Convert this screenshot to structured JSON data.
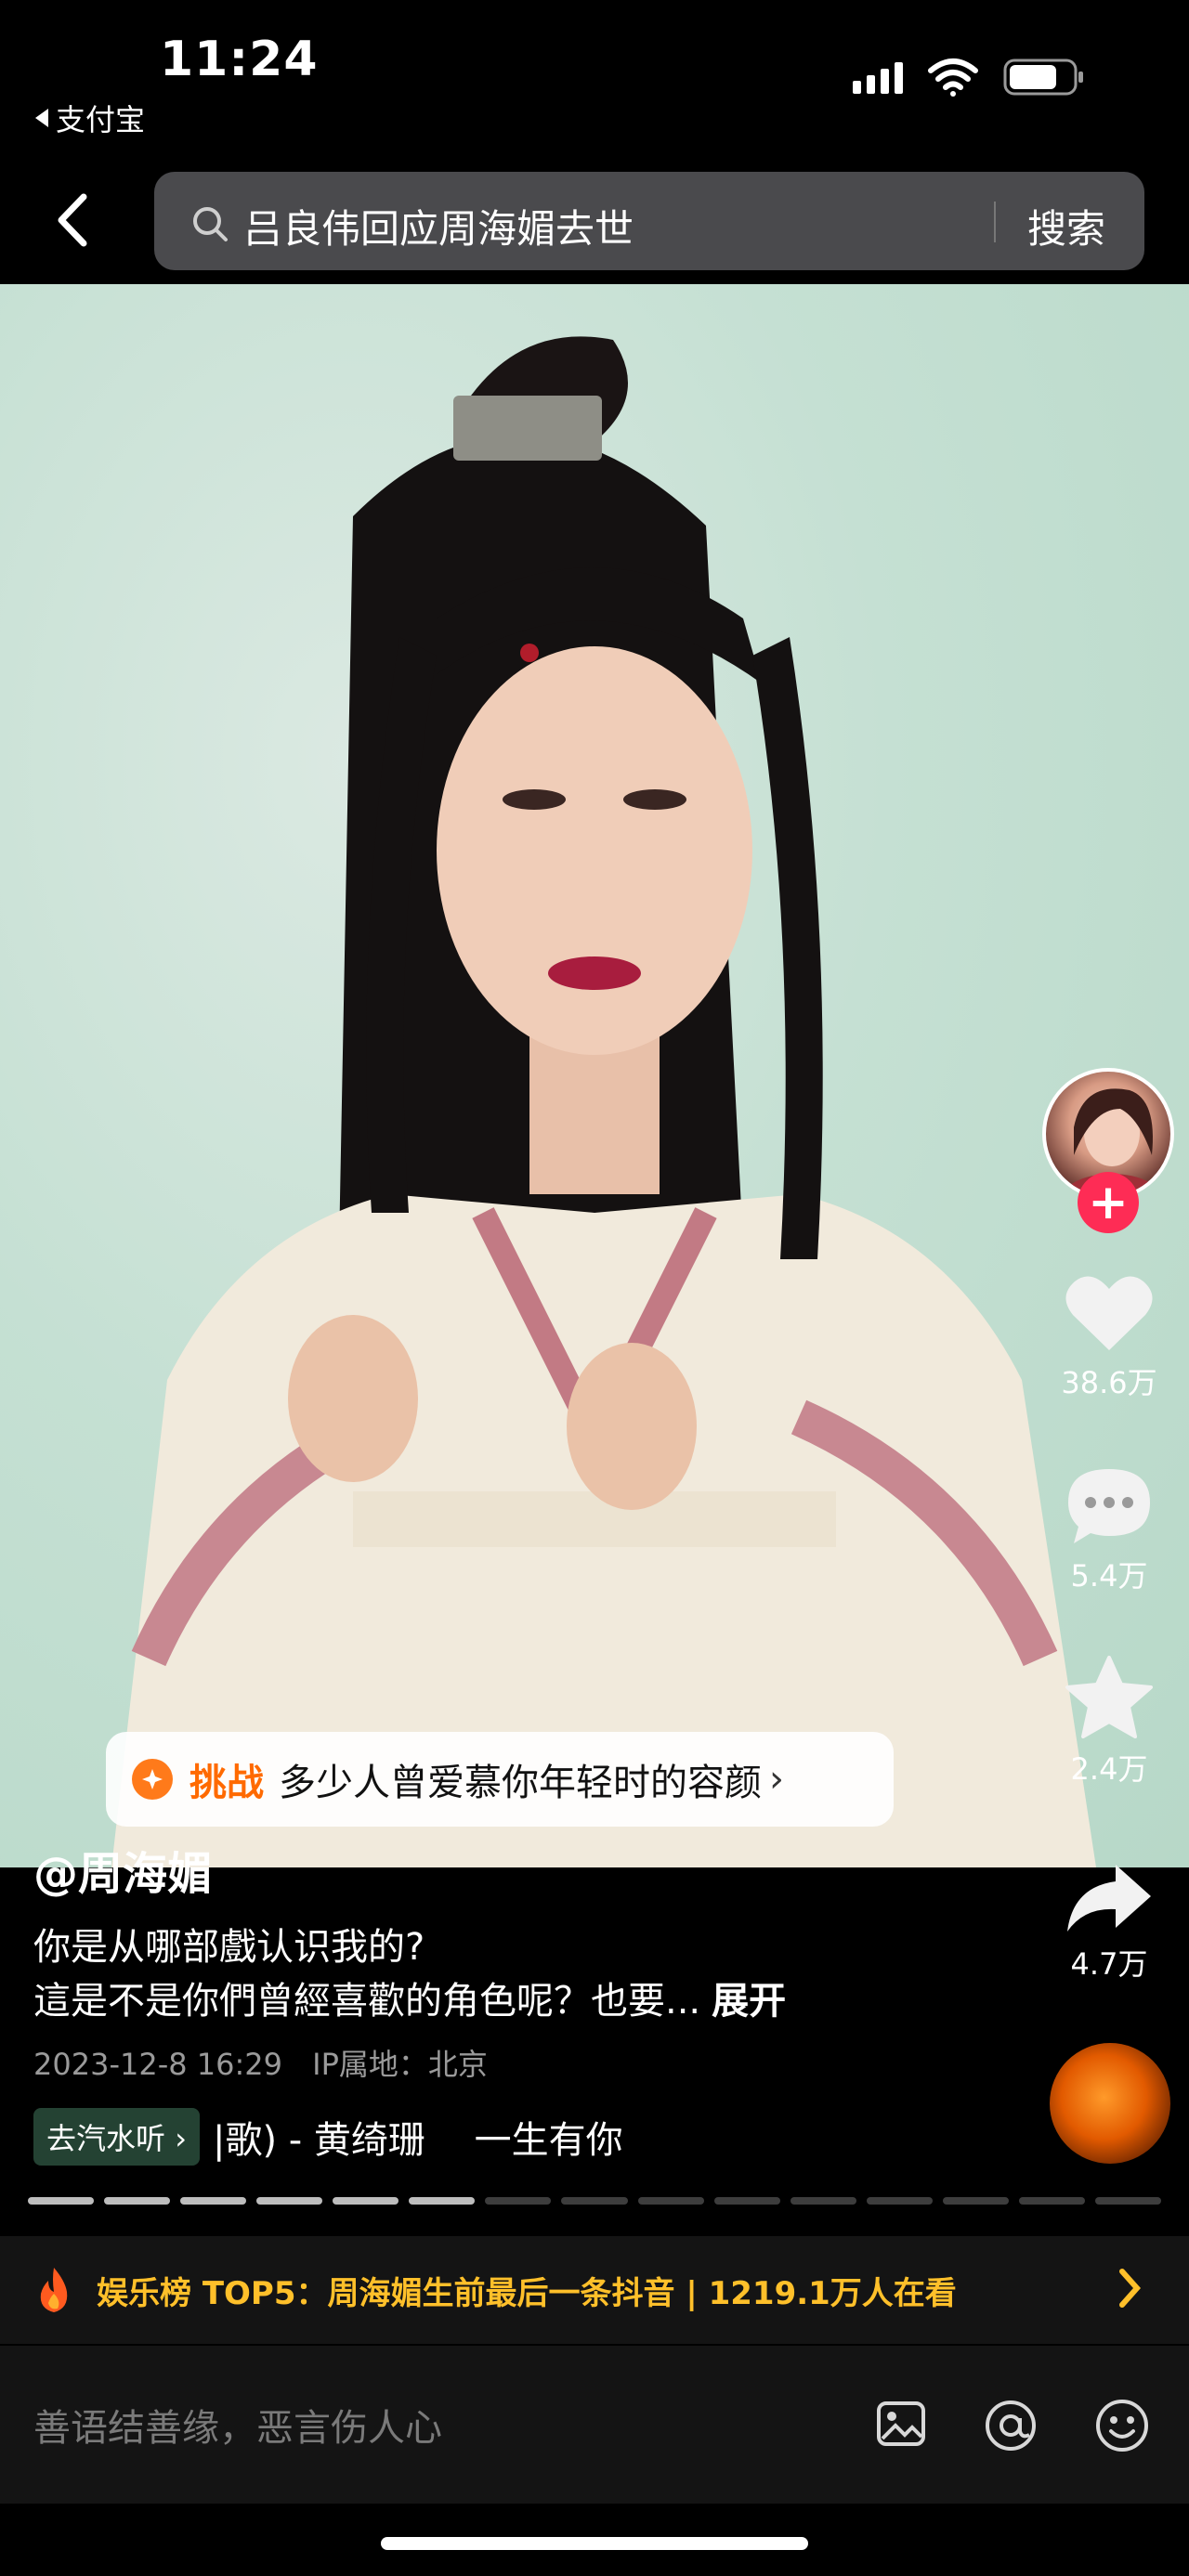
{
  "status_bar": {
    "time": "11:24",
    "back_app": "支付宝"
  },
  "search": {
    "query": "吕良伟回应周海媚去世",
    "button": "搜索"
  },
  "challenge": {
    "tag": "挑战",
    "text": "多少人曾爱慕你年轻时的容颜"
  },
  "rail": {
    "likes": "38.6万",
    "comments": "5.4万",
    "favorites": "2.4万",
    "shares": "4.7万"
  },
  "post": {
    "author": "@周海媚",
    "line1": "你是从哪部戲认识我的?",
    "line2": "這是不是你們曾經喜歡的角色呢？也要...",
    "expand": "展开",
    "date": "2023-12-8 16:29",
    "ip": "IP属地：北京"
  },
  "music": {
    "button": "去汽水听",
    "track": "|歌) - 黄绮珊　 一生有你"
  },
  "progress": {
    "total": 15,
    "watched": 6
  },
  "hot": {
    "text": "娱乐榜 TOP5：周海媚生前最后一条抖音 | 1219.1万人在看"
  },
  "comment": {
    "placeholder": "善语结善缘，恶言伤人心"
  },
  "colors": {
    "accent_red": "#fe2c55",
    "hot_gold": "#ffc02a",
    "challenge_orange": "#ff6a00"
  }
}
